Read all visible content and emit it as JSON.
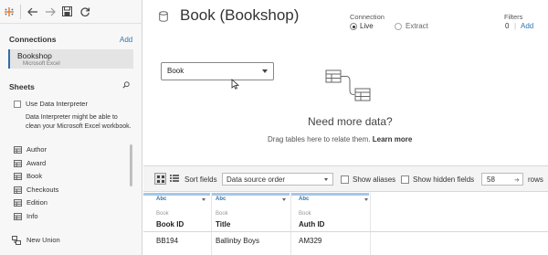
{
  "left_pane": {
    "connections_title": "Connections",
    "add_label": "Add",
    "connection": {
      "name": "Bookshop",
      "type": "Microsoft Excel"
    },
    "sheets_title": "Sheets",
    "data_interpreter": {
      "label": "Use Data Interpreter",
      "checked": false,
      "note": "Data Interpreter might be able to clean your Microsoft Excel workbook."
    },
    "tables": [
      "Author",
      "Award",
      "Book",
      "Checkouts",
      "Edition",
      "Info"
    ],
    "new_union": "New Union"
  },
  "header": {
    "title": "Book (Bookshop)",
    "connection_label": "Connection",
    "live_label": "Live",
    "extract_label": "Extract",
    "selected_connection": "Live",
    "filters_label": "Filters",
    "filters_count": "0",
    "filters_separator": "|",
    "filters_add": "Add"
  },
  "canvas": {
    "table_pill": "Book",
    "need_more": "Need more data?",
    "drag_hint": "Drag tables here to relate them.",
    "learn_more": "Learn more"
  },
  "grid_toolbar": {
    "sort_label": "Sort fields",
    "sort_value": "Data source order",
    "show_aliases": "Show aliases",
    "show_hidden": "Show hidden fields",
    "rows_value": "58",
    "rows_label": "rows"
  },
  "grid": {
    "columns": [
      {
        "type": "Abc",
        "source": "Book",
        "name": "Book ID"
      },
      {
        "type": "Abc",
        "source": "Book",
        "name": "Title"
      },
      {
        "type": "Abc",
        "source": "Book",
        "name": "Auth ID"
      }
    ],
    "rows": [
      [
        "BB194",
        "Ballinby Boys",
        "AM329"
      ]
    ]
  },
  "colors": {
    "accent": "#3276b1",
    "selected_connection_border": "#2f6eaa",
    "column_bar": "#a7c6e4"
  }
}
